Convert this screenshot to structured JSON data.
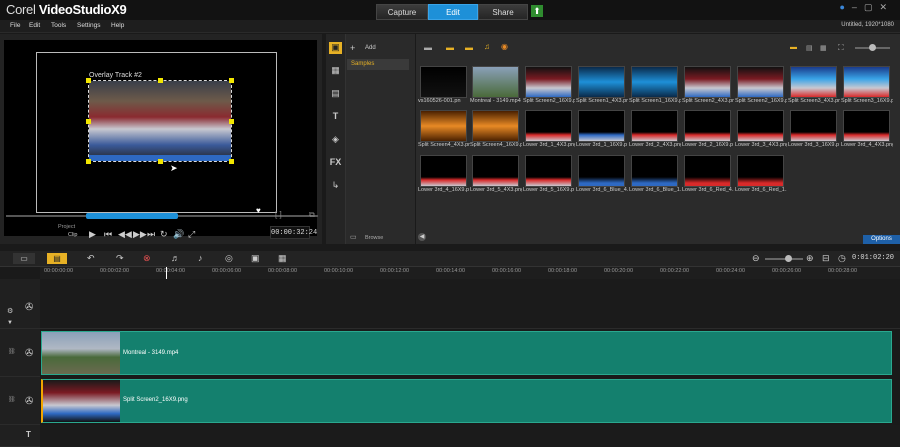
{
  "app": {
    "logo_part1": "Corel ",
    "logo_part2": "VideoStudioX9",
    "project_info": "Untitled, 1920*1080"
  },
  "top_tabs": [
    {
      "label": "Capture"
    },
    {
      "label": "Edit"
    },
    {
      "label": "Share"
    }
  ],
  "menu": [
    "File",
    "Edit",
    "Tools",
    "Settings",
    "Help"
  ],
  "player": {
    "overlay_label": "Overlay Track #2",
    "project_label": "Project",
    "clip_label": "Clip",
    "timecode": "00:00:32:24"
  },
  "library": {
    "add_label": "Add",
    "folder": "Samples",
    "browse_label": "Browse",
    "options_label": "Options",
    "thumbs": [
      "vs160526-001.pn",
      "Montreal - 3149.mp4",
      "Split Screen2_16X9.p",
      "Split Screen1_4X3.png",
      "Split Screen1_16X9.p",
      "Split Screen2_4X3.png",
      "Split Screen2_16X9.p",
      "Split Screen3_4X3.png",
      "Split Screen3_16X9.p",
      "Split Screen4_4X3.png",
      "Split Screen4_16X9.png",
      "Lower 3rd_1_4X3.png",
      "Lower 3rd_1_16X9.p",
      "Lower 3rd_2_4X3.png",
      "Lower 3rd_2_16X9.p",
      "Lower 3rd_3_4X3.png",
      "Lower 3rd_3_16X9.p",
      "Lower 3rd_4_4X3.png",
      "Lower 3rd_4_16X9.p",
      "Lower 3rd_5_4X3.png",
      "Lower 3rd_5_16X9.p",
      "Lower 3rd_6_Blue_4...",
      "Lower 3rd_6_Blue_1...",
      "Lower 3rd_6_Red_4...",
      "Lower 3rd_6_Red_1..."
    ]
  },
  "timeline": {
    "end_timecode": "0:01:02:20",
    "ruler": [
      "00:00:00:00",
      "00:00:02:00",
      "00:00:04:00",
      "00:00:06:00",
      "00:00:08:00",
      "00:00:10:00",
      "00:00:12:00",
      "00:00:14:00",
      "00:00:16:00",
      "00:00:18:00",
      "00:00:20:00",
      "00:00:22:00",
      "00:00:24:00",
      "00:00:26:00",
      "00:00:28:00"
    ],
    "clips": [
      {
        "label": "Montreal - 3149.mp4"
      },
      {
        "label": "Split Screen2_16X9.png"
      }
    ]
  },
  "colors": {
    "accent": "#1e90d8",
    "clip": "#14806e",
    "handle": "#f2e600"
  }
}
